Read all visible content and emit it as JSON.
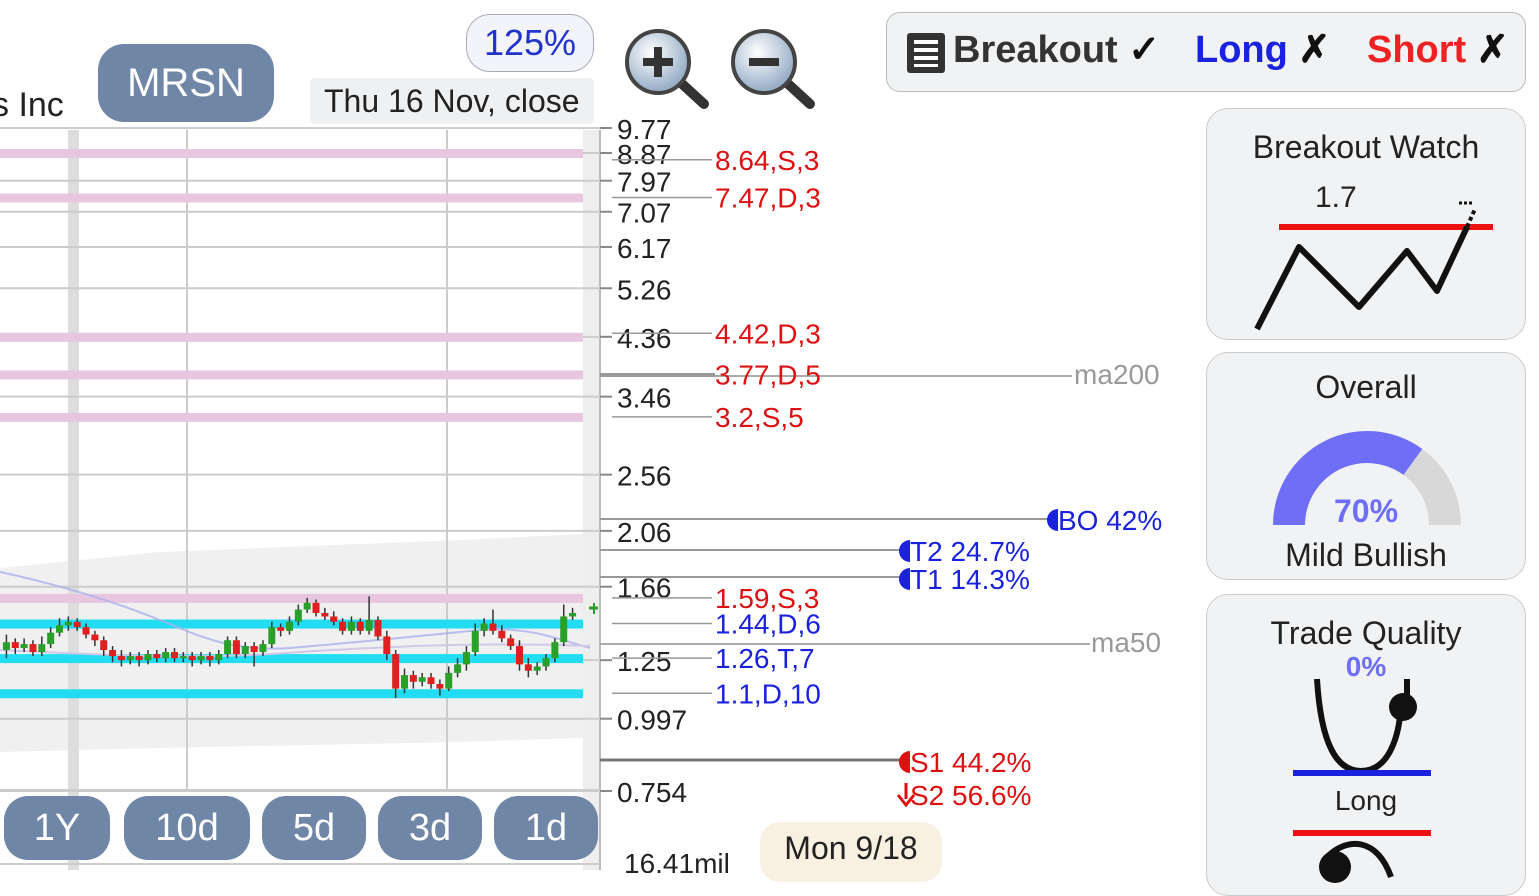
{
  "header": {
    "company_name_partial": "s Inc",
    "ticker": "MRSN",
    "zoom_level": "125%",
    "chart_date": "Thu 16 Nov, close"
  },
  "toolbar": {
    "zoom_in_icon": "magnifier-plus-icon",
    "zoom_out_icon": "magnifier-minus-icon"
  },
  "toggles": {
    "menu_icon": "list-icon",
    "breakout_label": "Breakout",
    "breakout_mark": "✓",
    "long_label": "Long",
    "long_mark": "✗",
    "short_label": "Short",
    "short_mark": "✗",
    "colors": {
      "breakout": "#333333",
      "long": "#1a22dd",
      "short": "#ee2222"
    }
  },
  "price_axis": {
    "ticks": [
      "9.77",
      "8.87",
      "7.97",
      "7.07",
      "6.17",
      "5.26",
      "4.36",
      "3.46",
      "2.56",
      "2.06",
      "1.66",
      "1.25",
      "0.997",
      "0.754"
    ],
    "volume_label": "16.41mil"
  },
  "levels": {
    "resistance": [
      {
        "label": "8.64,S,3",
        "value": 8.64
      },
      {
        "label": "7.47,D,3",
        "value": 7.47
      },
      {
        "label": "4.42,D,3",
        "value": 4.42
      },
      {
        "label": "3.77,D,5",
        "value": 3.77
      },
      {
        "label": "3.2,S,5",
        "value": 3.2
      },
      {
        "label": "1.59,S,3",
        "value": 1.59
      }
    ],
    "support": [
      {
        "label": "1.44,D,6",
        "value": 1.44
      },
      {
        "label": "1.26,T,7",
        "value": 1.26
      },
      {
        "label": "1.1,D,10",
        "value": 1.1
      }
    ],
    "targets": [
      {
        "label": "BO 42%",
        "color": "#1a22dd"
      },
      {
        "label": "T2 24.7%",
        "color": "#1a22dd"
      },
      {
        "label": "T1 14.3%",
        "color": "#1a22dd"
      },
      {
        "label": "S1 44.2%",
        "color": "#dd1111"
      },
      {
        "label": "S2 56.6%",
        "color": "#dd1111"
      }
    ],
    "moving_averages": {
      "ma200": "ma200",
      "ma50": "ma50"
    }
  },
  "panels": {
    "breakout_watch": {
      "title": "Breakout Watch",
      "value": "1.7"
    },
    "overall": {
      "title": "Overall",
      "percent": "70%",
      "percent_value": 0.7,
      "sentiment": "Mild Bullish"
    },
    "trade_quality": {
      "title": "Trade Quality",
      "percent": "0%",
      "direction": "Long"
    }
  },
  "ranges": [
    "1Y",
    "10d",
    "5d",
    "3d",
    "1d"
  ],
  "bottom_date": "Mon 9/18",
  "candles": [
    [
      1.3,
      1.34,
      1.38,
      1.26
    ],
    [
      1.34,
      1.31,
      1.36,
      1.28
    ],
    [
      1.31,
      1.33,
      1.36,
      1.29
    ],
    [
      1.33,
      1.29,
      1.35,
      1.27
    ],
    [
      1.29,
      1.33,
      1.37,
      1.27
    ],
    [
      1.33,
      1.39,
      1.42,
      1.31
    ],
    [
      1.39,
      1.43,
      1.47,
      1.37
    ],
    [
      1.43,
      1.45,
      1.48,
      1.4
    ],
    [
      1.45,
      1.42,
      1.47,
      1.4
    ],
    [
      1.42,
      1.38,
      1.44,
      1.36
    ],
    [
      1.38,
      1.35,
      1.4,
      1.32
    ],
    [
      1.35,
      1.3,
      1.37,
      1.27
    ],
    [
      1.3,
      1.27,
      1.32,
      1.24
    ],
    [
      1.27,
      1.25,
      1.3,
      1.22
    ],
    [
      1.25,
      1.27,
      1.29,
      1.23
    ],
    [
      1.27,
      1.25,
      1.29,
      1.22
    ],
    [
      1.25,
      1.28,
      1.3,
      1.23
    ],
    [
      1.28,
      1.26,
      1.3,
      1.24
    ],
    [
      1.26,
      1.29,
      1.31,
      1.24
    ],
    [
      1.29,
      1.26,
      1.31,
      1.24
    ],
    [
      1.26,
      1.27,
      1.29,
      1.24
    ],
    [
      1.27,
      1.25,
      1.29,
      1.22
    ],
    [
      1.25,
      1.27,
      1.29,
      1.23
    ],
    [
      1.27,
      1.25,
      1.29,
      1.22
    ],
    [
      1.25,
      1.28,
      1.3,
      1.23
    ],
    [
      1.28,
      1.35,
      1.37,
      1.26
    ],
    [
      1.35,
      1.28,
      1.37,
      1.26
    ],
    [
      1.28,
      1.32,
      1.34,
      1.26
    ],
    [
      1.32,
      1.29,
      1.34,
      1.22
    ],
    [
      1.29,
      1.33,
      1.35,
      1.27
    ],
    [
      1.33,
      1.42,
      1.45,
      1.31
    ],
    [
      1.42,
      1.4,
      1.44,
      1.37
    ],
    [
      1.4,
      1.45,
      1.48,
      1.38
    ],
    [
      1.45,
      1.52,
      1.55,
      1.43
    ],
    [
      1.52,
      1.56,
      1.59,
      1.5
    ],
    [
      1.56,
      1.5,
      1.58,
      1.48
    ],
    [
      1.5,
      1.48,
      1.53,
      1.46
    ],
    [
      1.48,
      1.45,
      1.51,
      1.43
    ],
    [
      1.45,
      1.4,
      1.47,
      1.38
    ],
    [
      1.4,
      1.45,
      1.48,
      1.38
    ],
    [
      1.45,
      1.4,
      1.47,
      1.38
    ],
    [
      1.4,
      1.46,
      1.6,
      1.38
    ],
    [
      1.46,
      1.37,
      1.48,
      1.35
    ],
    [
      1.37,
      1.28,
      1.4,
      1.25
    ],
    [
      1.28,
      1.12,
      1.3,
      1.08
    ],
    [
      1.12,
      1.18,
      1.21,
      1.1
    ],
    [
      1.18,
      1.15,
      1.2,
      1.12
    ],
    [
      1.15,
      1.17,
      1.19,
      1.13
    ],
    [
      1.17,
      1.14,
      1.19,
      1.12
    ],
    [
      1.14,
      1.12,
      1.16,
      1.09
    ],
    [
      1.12,
      1.19,
      1.22,
      1.11
    ],
    [
      1.19,
      1.23,
      1.26,
      1.17
    ],
    [
      1.23,
      1.29,
      1.32,
      1.2
    ],
    [
      1.29,
      1.4,
      1.44,
      1.27
    ],
    [
      1.4,
      1.44,
      1.47,
      1.37
    ],
    [
      1.44,
      1.4,
      1.52,
      1.38
    ],
    [
      1.4,
      1.36,
      1.43,
      1.34
    ],
    [
      1.36,
      1.32,
      1.38,
      1.3
    ],
    [
      1.32,
      1.23,
      1.35,
      1.2
    ],
    [
      1.23,
      1.2,
      1.26,
      1.17
    ],
    [
      1.2,
      1.22,
      1.24,
      1.18
    ],
    [
      1.22,
      1.26,
      1.28,
      1.2
    ],
    [
      1.26,
      1.34,
      1.36,
      1.24
    ],
    [
      1.34,
      1.48,
      1.55,
      1.32
    ],
    [
      1.48,
      1.5,
      1.53,
      1.46
    ]
  ]
}
